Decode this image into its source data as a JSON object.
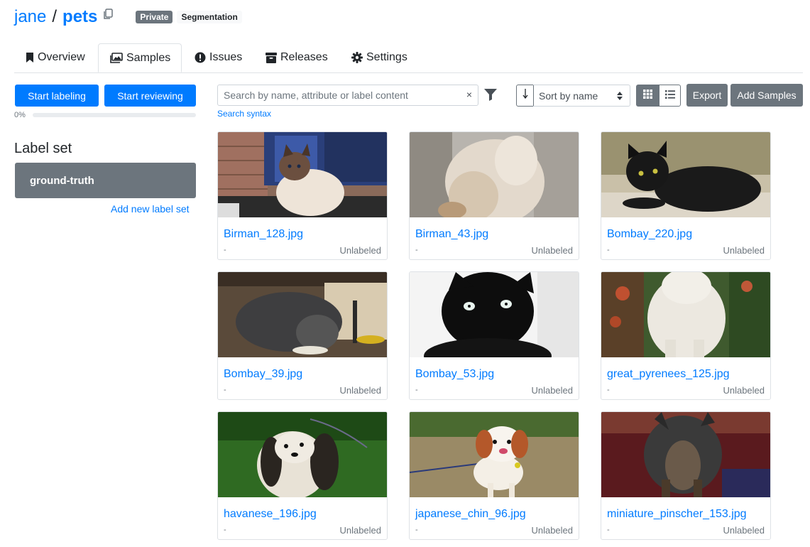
{
  "header": {
    "owner": "jane",
    "separator": "/",
    "repo": "pets",
    "badge_private": "Private",
    "badge_type": "Segmentation"
  },
  "tabs": [
    {
      "label": "Overview",
      "icon": "bookmark-icon"
    },
    {
      "label": "Samples",
      "icon": "images-icon"
    },
    {
      "label": "Issues",
      "icon": "exclamation-circle-icon"
    },
    {
      "label": "Releases",
      "icon": "box-icon"
    },
    {
      "label": "Settings",
      "icon": "gear-icon"
    }
  ],
  "active_tab": "Samples",
  "left": {
    "start_labeling": "Start labeling",
    "start_reviewing": "Start reviewing",
    "progress_label": "0%",
    "progress_fraction": 0,
    "labelset_title": "Label set",
    "labelsets": [
      "ground-truth"
    ],
    "add_labelset": "Add new label set"
  },
  "toolbar": {
    "search_placeholder": "Search by name, attribute or label content",
    "clear": "×",
    "search_syntax": "Search syntax",
    "sort_value": "Sort by name",
    "export": "Export",
    "add_samples": "Add Samples"
  },
  "samples": [
    {
      "name": "Birman_128.jpg",
      "dash": "-",
      "status": "Unlabeled",
      "thumb": "cream-cat-brick"
    },
    {
      "name": "Birman_43.jpg",
      "dash": "-",
      "status": "Unlabeled",
      "thumb": "fluffy-cat-closeup"
    },
    {
      "name": "Bombay_220.jpg",
      "dash": "-",
      "status": "Unlabeled",
      "thumb": "black-cat-lying"
    },
    {
      "name": "Bombay_39.jpg",
      "dash": "-",
      "status": "Unlabeled",
      "thumb": "dark-cat-eating"
    },
    {
      "name": "Bombay_53.jpg",
      "dash": "-",
      "status": "Unlabeled",
      "thumb": "black-cat-face"
    },
    {
      "name": "great_pyrenees_125.jpg",
      "dash": "-",
      "status": "Unlabeled",
      "thumb": "white-dog-garden"
    },
    {
      "name": "havanese_196.jpg",
      "dash": "-",
      "status": "Unlabeled",
      "thumb": "havanese-grass"
    },
    {
      "name": "japanese_chin_96.jpg",
      "dash": "-",
      "status": "Unlabeled",
      "thumb": "chin-dog-dirt"
    },
    {
      "name": "miniature_pinscher_153.jpg",
      "dash": "-",
      "status": "Unlabeled",
      "thumb": "pinscher-dark"
    }
  ],
  "colors": {
    "primary": "#007bff",
    "secondary": "#6c757d",
    "border": "#dee2e6"
  }
}
